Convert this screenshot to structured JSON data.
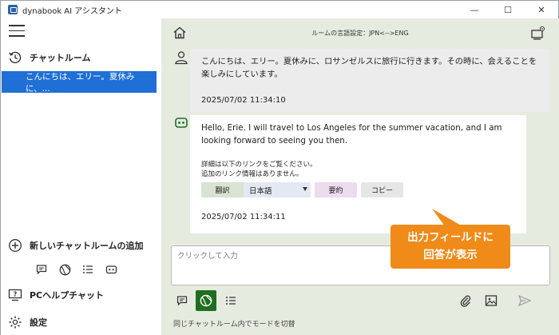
{
  "window": {
    "title": "dynabook AI アシスタント",
    "controls": {
      "minimize": "—",
      "maximize": "☐",
      "close": "✕"
    }
  },
  "sidebar": {
    "history_label": "チャットルーム",
    "history_items": [
      {
        "label": "こんにちは、エリー。夏休みに、..."
      }
    ],
    "new_chat_label": "新しいチャットルームの追加",
    "mode_icons": [
      "chat-bubble-icon",
      "globe-icon",
      "list-icon",
      "robot-icon"
    ],
    "pc_help_label": "PCヘルプチャット",
    "settings_label": "設定"
  },
  "chat": {
    "room_language": "ルームの言語設定：JPN<-->ENG",
    "messages": [
      {
        "role": "user",
        "text": "こんにちは、エリー。夏休みに、ロサンゼルスに旅行に行きます。その時に、会えることを楽しみにしています。",
        "timestamp": "2025/07/02 11:34:10"
      },
      {
        "role": "assistant",
        "text": "Hello, Erie. I will travel to Los Angeles for the summer vacation, and I am looking forward to seeing you then.",
        "note_line1": "詳細は以下のリンクをご覧ください。",
        "note_line2": "追加のリンク情報はありません。",
        "translate_label": "翻訳",
        "language_selected": "日本語",
        "summary_label": "要約",
        "copy_label": "コピー",
        "timestamp": "2025/07/02 11:34:11"
      }
    ]
  },
  "callout": {
    "line1": "出力フィールドに",
    "line2": "回答が表示",
    "color": "#f08a19"
  },
  "input": {
    "placeholder": "クリックして入力"
  },
  "footer": {
    "hint": "同じチャットルーム内でモードを切替"
  },
  "colors": {
    "accent": "#1f6fd6",
    "active_mode": "#1f6e1f",
    "main_bg": "#e6ebe0"
  }
}
